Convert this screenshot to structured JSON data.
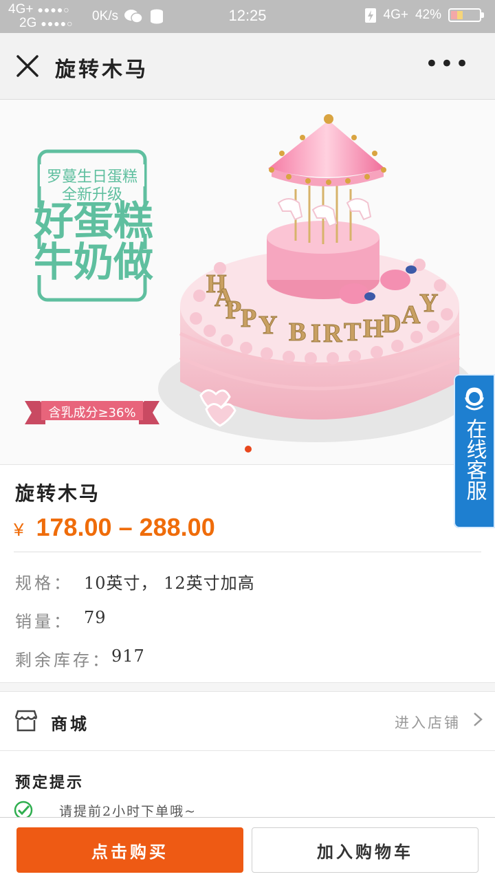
{
  "status_bar": {
    "network1": "4G+",
    "network2": "2G",
    "speed": "0K/s",
    "time": "12:25",
    "network3": "4G+",
    "battery_text": "42%",
    "battery_level": 0.42
  },
  "header": {
    "title": "旋转木马",
    "close_icon": "close-icon",
    "more_icon": "more-icon"
  },
  "banner": {
    "promo_line1": "罗蔓生日蛋糕",
    "promo_line2": "全新升级",
    "promo_big1": "好蛋糕",
    "promo_big2": "牛奶做",
    "ribbon_text": "含乳成分≥36%",
    "candles_text": "HAPPY BIRTHDAY",
    "slide_count": 1,
    "active_slide": 1
  },
  "customer_service": {
    "label": "在线客服",
    "icon": "headset-icon"
  },
  "product": {
    "name": "旋转木马",
    "currency": "¥",
    "price_range": "178.00 – 288.00"
  },
  "specs": [
    {
      "label": "规格：",
      "value": "10英寸， 12英寸加高"
    },
    {
      "label": "销量：",
      "value": "79"
    },
    {
      "label": "剩余库存：",
      "value": "917"
    }
  ],
  "store": {
    "name": "商城",
    "enter_label": "进入店铺",
    "icon": "store-icon"
  },
  "notice": {
    "title": "预定提示",
    "items": [
      "请提前2小时下单哦~"
    ]
  },
  "actions": {
    "buy_label": "点击购买",
    "cart_label": "加入购物车"
  },
  "colors": {
    "accent": "#ee5a14",
    "price": "#ef6c0a",
    "cs_blue": "#1e7fd0",
    "promo_green": "#5fbf9f",
    "ribbon_pink": "#e8647b"
  }
}
